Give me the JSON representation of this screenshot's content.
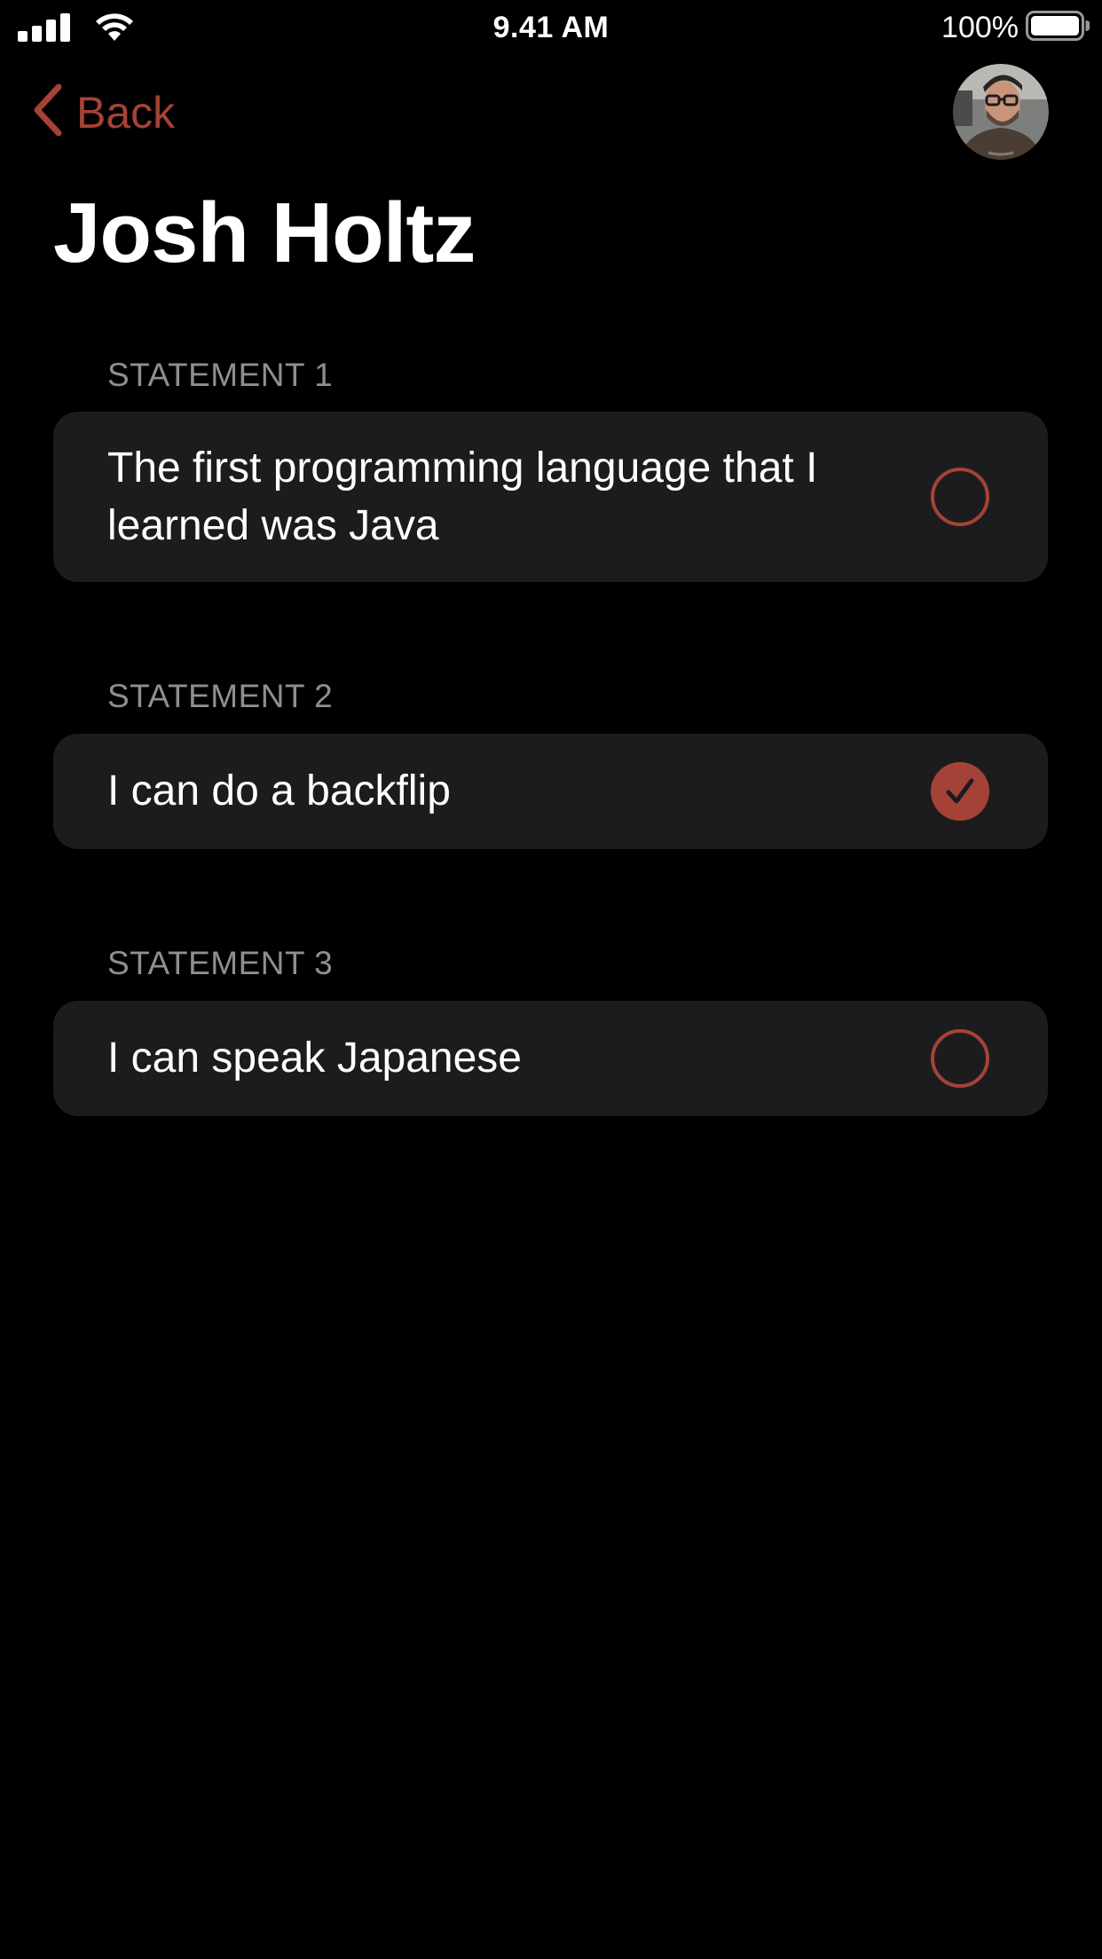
{
  "status_bar": {
    "time": "9.41 AM",
    "battery_percent": "100%",
    "icons": [
      "signal-icon",
      "wifi-icon",
      "battery-icon"
    ]
  },
  "nav": {
    "back_label": "Back",
    "back_icon": "chevron-left-icon",
    "avatar": "profile-photo"
  },
  "title": "Josh Holtz",
  "statements": [
    {
      "header": "STATEMENT 1",
      "text": "The first programming language that I learned was Java",
      "selected": false
    },
    {
      "header": "STATEMENT 2",
      "text": "I can do a backflip",
      "selected": true
    },
    {
      "header": "STATEMENT 3",
      "text": "I can speak Japanese",
      "selected": false
    }
  ],
  "colors": {
    "accent": "#a54237",
    "background": "#000000",
    "card": "#1c1c1e",
    "secondary_text": "#8e8e93"
  }
}
